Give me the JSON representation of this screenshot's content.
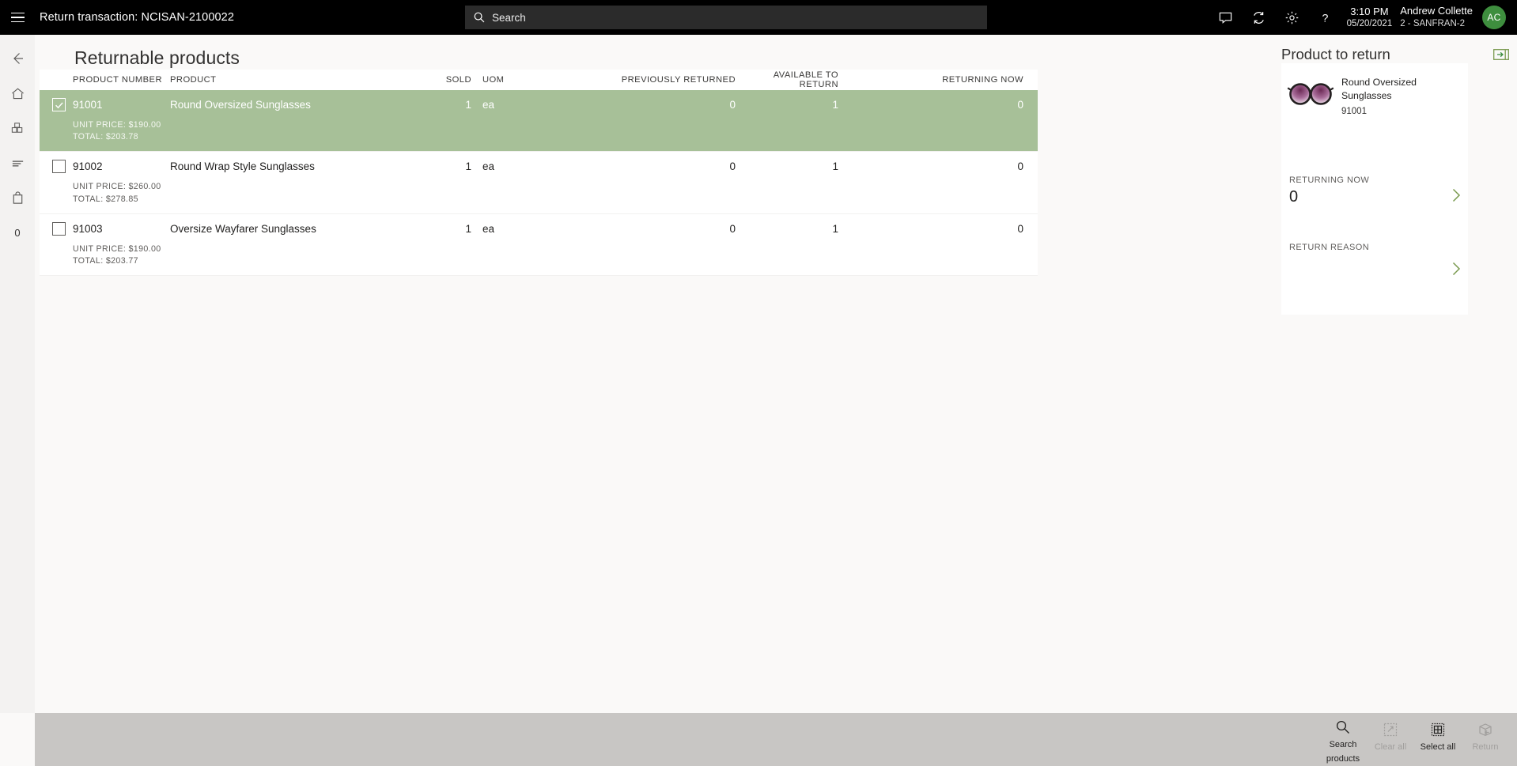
{
  "topbar": {
    "menu_icon": "hamburger-icon",
    "title": "Return transaction: NCISAN-2100022",
    "search": {
      "icon": "search-icon",
      "placeholder": "Search",
      "value": ""
    },
    "icons": [
      {
        "name": "chat-icon"
      },
      {
        "name": "sync-icon"
      },
      {
        "name": "gear-icon"
      },
      {
        "name": "help-icon"
      }
    ],
    "time": "3:10 PM",
    "date": "05/20/2021",
    "user_name": "Andrew Collette",
    "user_store": "2 - SANFRAN-2",
    "avatar_initials": "AC",
    "avatar_color": "#3e8e3e",
    "background": "#000000"
  },
  "rail": {
    "items": [
      {
        "name": "back-icon",
        "label": "Back"
      },
      {
        "name": "home-icon",
        "label": "Home"
      },
      {
        "name": "products-icon",
        "label": "Products"
      },
      {
        "name": "journal-icon",
        "label": "Journal"
      },
      {
        "name": "bag-icon",
        "label": "Cart"
      },
      {
        "name": "cart-count",
        "label": "0"
      }
    ]
  },
  "main": {
    "page_title": "Returnable products",
    "columns": [
      "PRODUCT NUMBER",
      "PRODUCT",
      "SOLD",
      "UOM",
      "PREVIOUSLY RETURNED",
      "AVAILABLE TO RETURN",
      "RETURNING NOW"
    ],
    "rows": [
      {
        "selected": true,
        "checked": true,
        "product_number": "91001",
        "product": "Round Oversized Sunglasses",
        "sold": "1",
        "uom": "ea",
        "previously_returned": "0",
        "available_to_return": "1",
        "returning_now": "0",
        "unit_price": "UNIT PRICE: $190.00",
        "total": "TOTAL: $203.78"
      },
      {
        "selected": false,
        "checked": false,
        "product_number": "91002",
        "product": "Round Wrap Style Sunglasses",
        "sold": "1",
        "uom": "ea",
        "previously_returned": "0",
        "available_to_return": "1",
        "returning_now": "0",
        "unit_price": "UNIT PRICE: $260.00",
        "total": "TOTAL: $278.85"
      },
      {
        "selected": false,
        "checked": false,
        "product_number": "91003",
        "product": "Oversize Wayfarer Sunglasses",
        "sold": "1",
        "uom": "ea",
        "previously_returned": "0",
        "available_to_return": "1",
        "returning_now": "0",
        "unit_price": "UNIT PRICE: $190.00",
        "total": "TOTAL: $203.77"
      }
    ],
    "selected_row_color": "#a7c098"
  },
  "right_panel": {
    "title": "Product to return",
    "expand_icon": "expand-panel-icon",
    "product": {
      "image": "sunglasses-thumbnail",
      "name": "Round Oversized Sunglasses",
      "number": "91001"
    },
    "fields": [
      {
        "label": "RETURNING NOW",
        "value": "0",
        "chevron": "chevron-right-icon"
      },
      {
        "label": "RETURN REASON",
        "value": "",
        "chevron": "chevron-right-icon"
      }
    ]
  },
  "command_bar": {
    "buttons": [
      {
        "name": "search-products-button",
        "icon": "search-icon",
        "label_line1": "Search",
        "label_line2": "products",
        "disabled": false
      },
      {
        "name": "clear-all-button",
        "icon": "clear-icon",
        "label_line1": "Clear all",
        "label_line2": "",
        "disabled": true
      },
      {
        "name": "select-all-button",
        "icon": "select-all-icon",
        "label_line1": "Select all",
        "label_line2": "",
        "disabled": false
      },
      {
        "name": "return-button",
        "icon": "return-box-icon",
        "label_line1": "Return",
        "label_line2": "",
        "disabled": true
      }
    ],
    "background": "#c8c6c4"
  }
}
